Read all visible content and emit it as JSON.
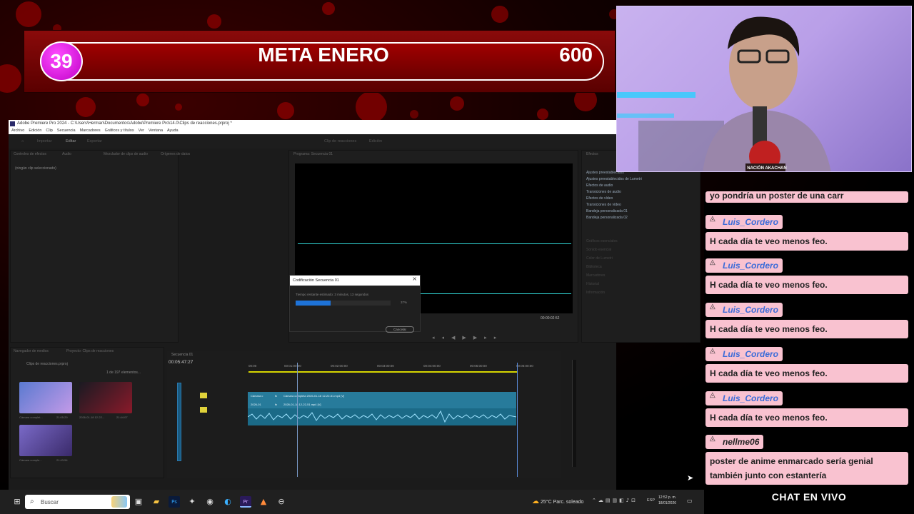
{
  "goal_banner": {
    "current": "39",
    "title": "META ENERO",
    "target": "600"
  },
  "premiere": {
    "title": "Adobe Premiere Pro 2024 - C:\\Users\\Herman\\Documentos\\Adobe\\Premiere Pro\\14.0\\Clips de reacciones.prproj *",
    "menu": [
      "Archivo",
      "Edición",
      "Clip",
      "Secuencia",
      "Marcadores",
      "Gráficos y títulos",
      "Ver",
      "Ventana",
      "Ayuda"
    ],
    "workspace_tabs": [
      "Importar",
      "Editar",
      "Exportar"
    ],
    "header_tabs": [
      "Clip de reacciones",
      "Edición"
    ],
    "source_panel": {
      "tabs": [
        "Controles de efectos",
        "Audio",
        "Mezclador de clips de audio",
        "Orígenes de datos"
      ],
      "empty_text": "(ningún clip seleccionado)"
    },
    "program_panel": {
      "tab": "Programa: Secuencia 01",
      "timecode": "00:00:02:52"
    },
    "effects_panel": {
      "tab": "Efectos",
      "items": [
        "Ajustes preestablecidos",
        "Ajustes preestablecidos de Lumetri",
        "Efectos de audio",
        "Transiciones de audio",
        "Efectos de vídeo",
        "Transiciones de vídeo",
        "Bandeja personalizada 01",
        "Bandeja personalizada 02"
      ],
      "sub_panels": [
        "Gráficos esenciales",
        "Sonido esencial",
        "Color de Lumetri",
        "Biblioteca",
        "Marcadores",
        "Historial",
        "Información"
      ]
    },
    "export_dialog": {
      "title": "Codificación Secuencia 01",
      "remaining": "Tiempo restante estimado: 3 minutos, 13 segundos",
      "percent": "37%",
      "progress": 0.37,
      "cancel": "Cancelar"
    },
    "project_panel": {
      "tabs": [
        "Navegador de medios",
        "Proyecto: Clips de reacciones"
      ],
      "project_name": "Clips de reacciones.prproj",
      "item_count": "1 de 197 elementos...",
      "items": [
        {
          "name": "Cámara complet...",
          "duration": "21:05:29"
        },
        {
          "name": "2026-01-18 12-22...",
          "duration": "21:44:07"
        },
        {
          "name": "Cámara comple...",
          "duration": "21:43:54"
        }
      ]
    },
    "timeline": {
      "tab": "Secuencia 01",
      "timecode": "00:05:47:27",
      "ruler": [
        "00:00",
        "00:01:00:00",
        "00:02:00:00",
        "00:03:00:00",
        "00:04:00:00",
        "00:05:00:00",
        "00:06:00:00"
      ],
      "video_clip": "Cámara completa 2026-01-18 12-22-51.mp4 [V]",
      "audio_clip": "2026-01-18 12-22-51.mp4 [V]",
      "video_prefix": "Cámara c",
      "audio_prefix": "2026-01"
    },
    "status_timecode": "00:05:47:27"
  },
  "taskbar": {
    "search_placeholder": "Buscar",
    "weather": "25°C  Parc. soleado",
    "lang": "ESP",
    "time": "12:52 p. m.",
    "date": "18/01/2026"
  },
  "webcam": {
    "badge_text": "NACIÓN AKACHAN"
  },
  "chat": {
    "top_partial": "yo pondría un poster de una carr",
    "messages": [
      {
        "user": "Luis_Cordero",
        "text": "H cada día te veo menos feo."
      },
      {
        "user": "Luis_Cordero",
        "text": "H cada día te veo menos feo."
      },
      {
        "user": "Luis_Cordero",
        "text": "H cada día te veo menos feo."
      },
      {
        "user": "Luis_Cordero",
        "text": "H cada día te veo menos feo."
      },
      {
        "user": "Luis_Cordero",
        "text": "H cada día te veo menos feo."
      },
      {
        "user": "nellme06",
        "text": "poster de anime enmarcado sería genial también junto con estantería"
      }
    ],
    "label": "CHAT EN VIVO"
  },
  "colors": {
    "banner_red": "#8a0a0a",
    "counter_magenta": "#d000d8",
    "chat_bubble": "#f9c2d0",
    "username_blue": "#3a6bd8",
    "progress_blue": "#1e73d8",
    "clip_teal": "#277b9b",
    "timeline_yellow": "#d6d600"
  }
}
